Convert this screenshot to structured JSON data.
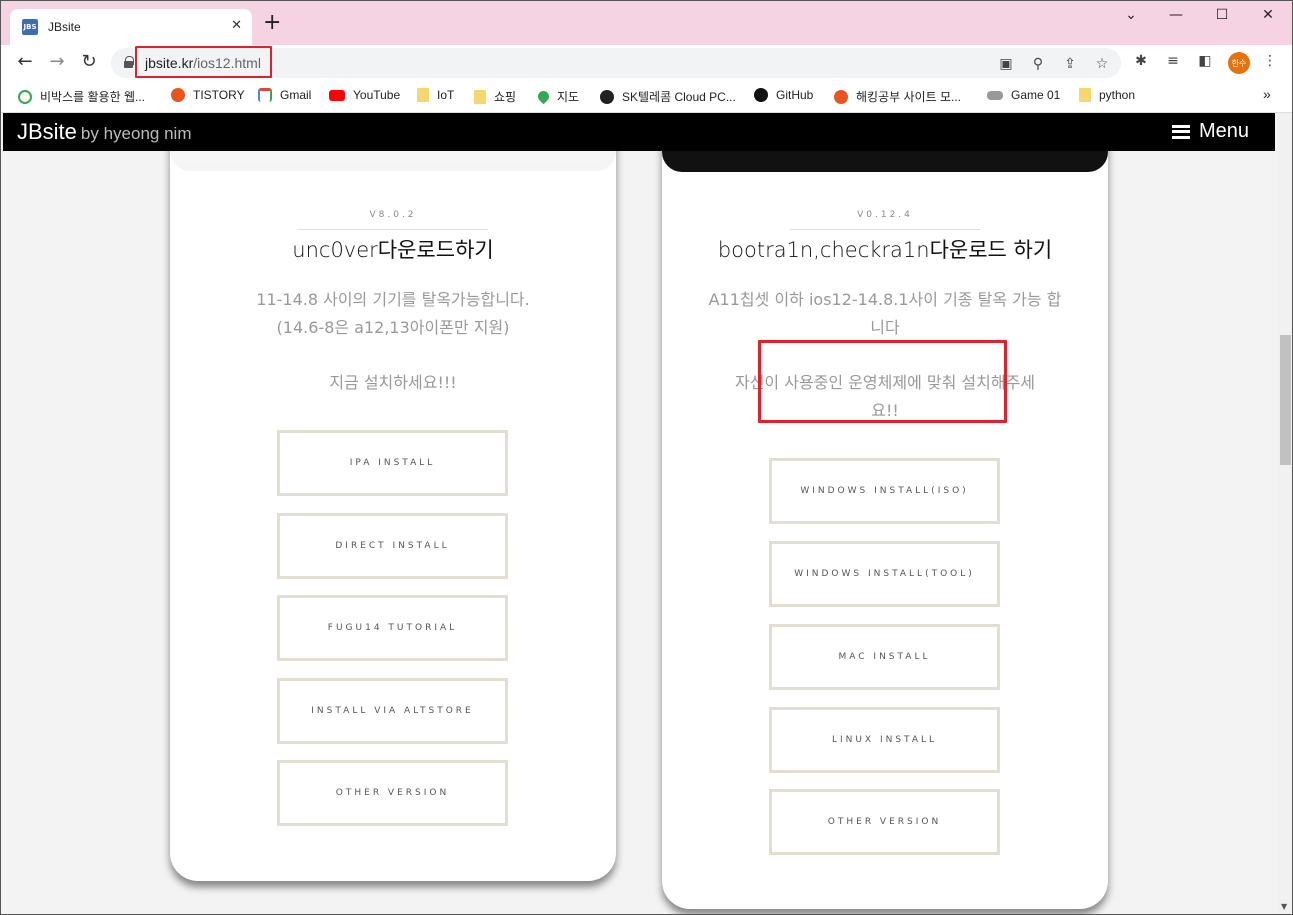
{
  "browser": {
    "tab_title": "JBsite",
    "favicon_text": "JBS",
    "url_domain": "jbsite.kr",
    "url_path": "/ios12.html",
    "profile_initials": "한수",
    "bookmarks": [
      {
        "label": "비박스를 활용한 웹...",
        "icon": "globe-icon"
      },
      {
        "label": "TISTORY",
        "icon": "tistory-icon"
      },
      {
        "label": "Gmail",
        "icon": "gmail-icon"
      },
      {
        "label": "YouTube",
        "icon": "youtube-icon"
      },
      {
        "label": "IoT",
        "icon": "folder-icon"
      },
      {
        "label": "쇼핑",
        "icon": "folder-icon"
      },
      {
        "label": "지도",
        "icon": "maps-icon"
      },
      {
        "label": "SK텔레콤 Cloud PC...",
        "icon": "globe-icon"
      },
      {
        "label": "GitHub",
        "icon": "github-icon"
      },
      {
        "label": "해킹공부 사이트 모...",
        "icon": "tistory-icon"
      },
      {
        "label": "Game 01",
        "icon": "gamepad-icon"
      },
      {
        "label": "python",
        "icon": "folder-icon"
      }
    ],
    "bookmarks_overflow": "»"
  },
  "site": {
    "logo": "JBsite",
    "logo_sub": "by hyeong nim",
    "menu_label": "Menu"
  },
  "cards": [
    {
      "version": "V8.0.2",
      "title": "unc0ver다운로드하기",
      "text_lines": [
        "11-14.8 사이의 기기를 탈옥가능합니다.",
        "(14.6-8은 a12,13아이폰만 지원)"
      ],
      "text2": "지금 설치하세요!!!",
      "buttons": [
        "IPA INSTALL",
        "DIRECT INSTALL",
        "FUGU14 TUTORIAL",
        "INSTALL VIA ALTSTORE",
        "OTHER VERSION"
      ]
    },
    {
      "version": "V0.12.4",
      "title": "bootra1n,checkra1n다운로드 하기",
      "text_lines": [
        "A11칩셋 이하 ios12-14.8.1사이 기종 탈옥 가능 합",
        "니다"
      ],
      "text2_lines": [
        "자신이 사용중인 운영체제에 맞춰 설치해주세",
        "요!!"
      ],
      "buttons": [
        "WINDOWS INSTALL(ISO)",
        "WINDOWS INSTALL(TOOL)",
        "MAC INSTALL",
        "LINUX INSTALL",
        "OTHER VERSION"
      ]
    }
  ],
  "colors": {
    "tabstrip": "#f6d3e3",
    "highlight": "#e0202a",
    "button_border": "#e2dfd2"
  }
}
